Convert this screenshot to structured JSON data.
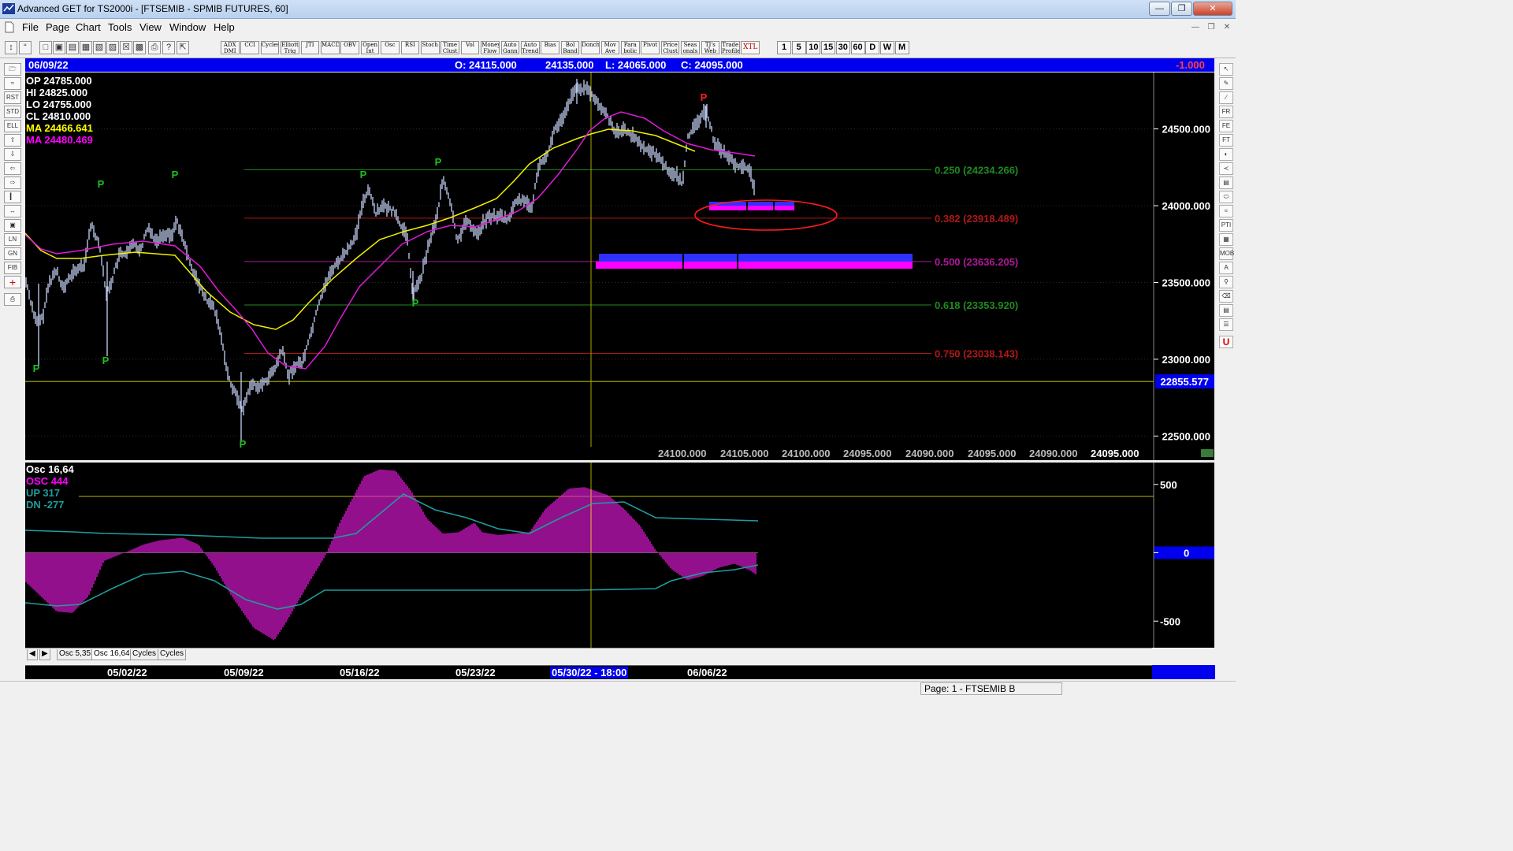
{
  "window": {
    "title": "Advanced GET for TS2000i - [FTSEMIB - SPMIB FUTURES, 60]",
    "min_label": "—",
    "max_label": "❐",
    "close_label": "✕"
  },
  "menu": [
    "File",
    "Page",
    "Chart",
    "Tools",
    "View",
    "Window",
    "Help"
  ],
  "toolbar": {
    "studies": [
      "ADX DMI",
      "CCI",
      "Cycles",
      "Elliott Trig",
      "JTI",
      "MACD",
      "OBV",
      "Open Int",
      "Osc",
      "RSI",
      "Stoch",
      "Time Clust",
      "Vol",
      "Money Flow",
      "Auto Gann",
      "Auto Trend",
      "Bias",
      "Bol Band",
      "Donch",
      "Mov Ave",
      "Para bolic",
      "Pivot",
      "Price Clust",
      "Seas onals",
      "TJ's Web",
      "Trade Profile",
      "XTL"
    ],
    "timeframes": [
      "1",
      "5",
      "10",
      "15",
      "30",
      "60",
      "D",
      "W",
      "M"
    ]
  },
  "infobar": {
    "date": "06/09/22",
    "open": "O: 24115.000",
    "high": "24135.000",
    "low": "L: 24065.000",
    "close": "C: 24095.000",
    "change": "-1.000"
  },
  "overlay": {
    "op": "OP  24785.000",
    "hi": "HI   24825.000",
    "lo": "LO  24755.000",
    "cl": "CL  24810.000",
    "ma1": "MA  24466.641",
    "ma2": "MA  24480.469"
  },
  "fib_levels": [
    {
      "label": "0.250 (24234.266)",
      "value": 24234.266,
      "color": "#1f8a1f"
    },
    {
      "label": "0.382 (23918.489)",
      "value": 23918.489,
      "color": "#b01818"
    },
    {
      "label": "0.500 (23636.205)",
      "value": 23636.205,
      "color": "#b01898"
    },
    {
      "label": "0.618 (23353.920)",
      "value": 23353.92,
      "color": "#1f8a1f"
    },
    {
      "label": "0.750 (23038.143)",
      "value": 23038.143,
      "color": "#b01818"
    }
  ],
  "price_axis": {
    "ticks": [
      "24500.000",
      "24000.000",
      "23500.000",
      "23000.000",
      "22500.000"
    ],
    "tick_values": [
      24500,
      24000,
      23500,
      23000,
      22500
    ],
    "marker": "22855.577",
    "marker_value": 22855.577
  },
  "projection_values": [
    "24100.000",
    "24105.000",
    "24100.000",
    "24095.000",
    "24090.000",
    "24095.000",
    "24090.000",
    "24095.000"
  ],
  "pivot_marker": "P",
  "osc": {
    "title": "Osc 16,64",
    "osc": "OSC 444",
    "up": "UP   317",
    "dn": "DN   -277",
    "ticks": [
      "500",
      "0",
      "-500"
    ]
  },
  "tabs": [
    "Osc 5,35",
    "Osc 16,64",
    "Cycles",
    "Cycles"
  ],
  "dates": [
    "05/02/22",
    "05/09/22",
    "05/16/22",
    "05/23/22",
    "05/30/22 - 18:00",
    "06/06/22"
  ],
  "status": "Page: 1 - FTSEMIB B",
  "chart_data": {
    "type": "line",
    "title": "",
    "series": [
      {
        "name": "",
        "x": [
          "05/02/22",
          "05/09/22",
          "05/16/22",
          "05/23/22",
          "05/30/22",
          "06/06/22",
          "06/09/22"
        ],
        "values": [
          23900,
          22700,
          23800,
          24150,
          24800,
          24450,
          24095
        ]
      }
    ],
    "ylim": [
      22400,
      24880
    ],
    "grid": false
  }
}
